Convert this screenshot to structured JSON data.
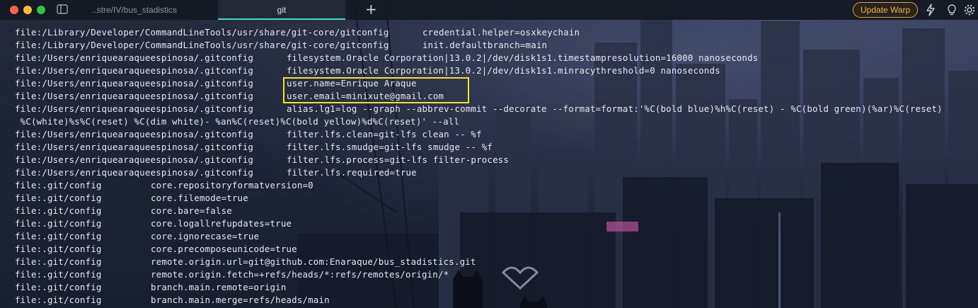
{
  "window": {
    "tabs": [
      {
        "label": "..stre/IV/bus_stadistics",
        "active": false
      },
      {
        "label": "git",
        "active": true
      }
    ],
    "new_tab_icon": "plus-icon",
    "update_button": "Update Warp",
    "right_icons": [
      "bolt-icon",
      "lightbulb-icon",
      "gear-icon"
    ],
    "accent_color": "#3ce0c8",
    "update_color": "#e8b64a"
  },
  "terminal": {
    "lines": [
      {
        "file": "file:/Library/Developer/CommandLineTools/usr/share/git-core/gitconfig",
        "value": "credential.helper=osxkeychain"
      },
      {
        "file": "file:/Library/Developer/CommandLineTools/usr/share/git-core/gitconfig",
        "value": "init.defaultbranch=main"
      },
      {
        "file": "file:/Users/enriquearaqueespinosa/.gitconfig",
        "value": "filesystem.Oracle Corporation|13.0.2|/dev/disk1s1.timestampresolution=16000 nanoseconds"
      },
      {
        "file": "file:/Users/enriquearaqueespinosa/.gitconfig",
        "value": "filesystem.Oracle Corporation|13.0.2|/dev/disk1s1.minracythreshold=0 nanoseconds"
      },
      {
        "file": "file:/Users/enriquearaqueespinosa/.gitconfig",
        "value": "user.name=Enrique Araque"
      },
      {
        "file": "file:/Users/enriquearaqueespinosa/.gitconfig",
        "value": "user.email=minixute@gmail.com"
      },
      {
        "file": "file:/Users/enriquearaqueespinosa/.gitconfig",
        "value": "alias.lg1=log --graph --abbrev-commit --decorate --format=format:'%C(bold blue)%h%C(reset) - %C(bold green)(%ar)%C(reset)"
      },
      {
        "file": "",
        "value": " %C(white)%s%C(reset) %C(dim white)- %an%C(reset)%C(bold yellow)%d%C(reset)' --all"
      },
      {
        "file": "file:/Users/enriquearaqueespinosa/.gitconfig",
        "value": "filter.lfs.clean=git-lfs clean -- %f"
      },
      {
        "file": "file:/Users/enriquearaqueespinosa/.gitconfig",
        "value": "filter.lfs.smudge=git-lfs smudge -- %f"
      },
      {
        "file": "file:/Users/enriquearaqueespinosa/.gitconfig",
        "value": "filter.lfs.process=git-lfs filter-process"
      },
      {
        "file": "file:/Users/enriquearaqueespinosa/.gitconfig",
        "value": "filter.lfs.required=true"
      },
      {
        "file": "file:.git/config",
        "value": "core.repositoryformatversion=0"
      },
      {
        "file": "file:.git/config",
        "value": "core.filemode=true"
      },
      {
        "file": "file:.git/config",
        "value": "core.bare=false"
      },
      {
        "file": "file:.git/config",
        "value": "core.logallrefupdates=true"
      },
      {
        "file": "file:.git/config",
        "value": "core.ignorecase=true"
      },
      {
        "file": "file:.git/config",
        "value": "core.precomposeunicode=true"
      },
      {
        "file": "file:.git/config",
        "value": "remote.origin.url=git@github.com:Enaraque/bus_stadistics.git"
      },
      {
        "file": "file:.git/config",
        "value": "remote.origin.fetch=+refs/heads/*:refs/remotes/origin/*"
      },
      {
        "file": "file:.git/config",
        "value": "branch.main.remote=origin"
      },
      {
        "file": "file:.git/config",
        "value": "branch.main.merge=refs/heads/main"
      }
    ],
    "highlight_color": "#f2e51f"
  }
}
